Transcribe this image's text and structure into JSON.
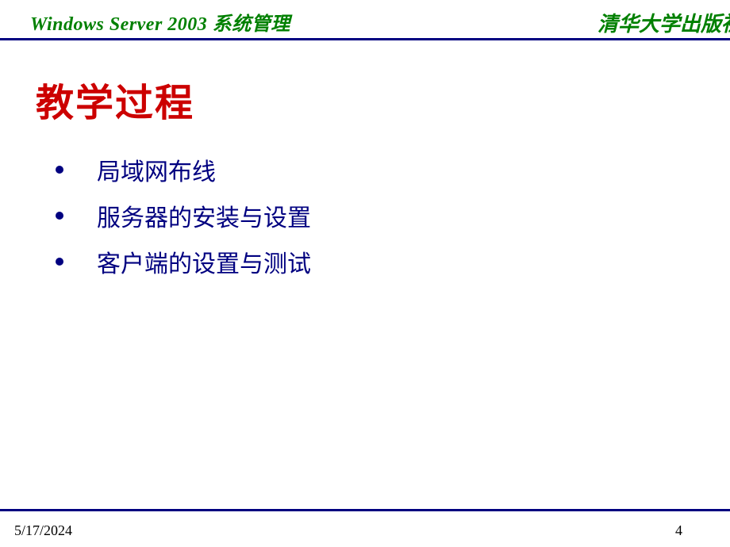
{
  "header": {
    "left_text": "Windows Server 2003 系统管理",
    "right_text": "清华大学出版社"
  },
  "slide": {
    "title": "教学过程",
    "bullets": [
      "局域网布线",
      "服务器的安装与设置",
      "客户端的设置与测试"
    ]
  },
  "footer": {
    "date": "5/17/2024",
    "page_number": "4"
  }
}
